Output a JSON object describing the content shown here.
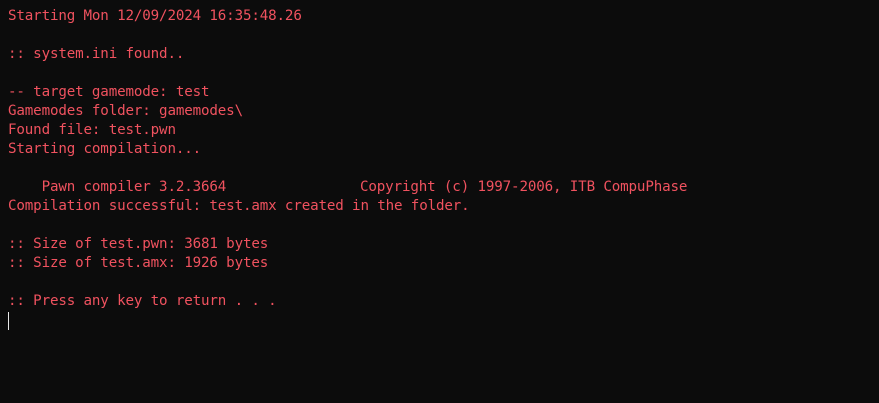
{
  "console": {
    "colors": {
      "background": "#0c0c0c",
      "red_text": "#f0525f",
      "white_text": "#e2e2e2"
    },
    "starting": "Starting Mon 12/09/2024 16:35:48.26",
    "system_ini": ":: system.ini found..",
    "target_gamemode": "-- target gamemode: test",
    "gamemodes_folder": "Gamemodes folder: gamemodes\\",
    "found_file": "Found file: test.pwn",
    "starting_compilation": "Starting compilation...",
    "pawn_compiler": "Pawn compiler 3.2.3664",
    "copyright": "Copyright (c) 1997-2006, ITB CompuPhase",
    "compilation_result": "Compilation successful: test.amx created in the folder.",
    "size_pwn": ":: Size of test.pwn: 3681 bytes",
    "size_amx": ":: Size of test.amx: 1926 bytes",
    "press_any_key": ":: Press any key to return . . ."
  }
}
